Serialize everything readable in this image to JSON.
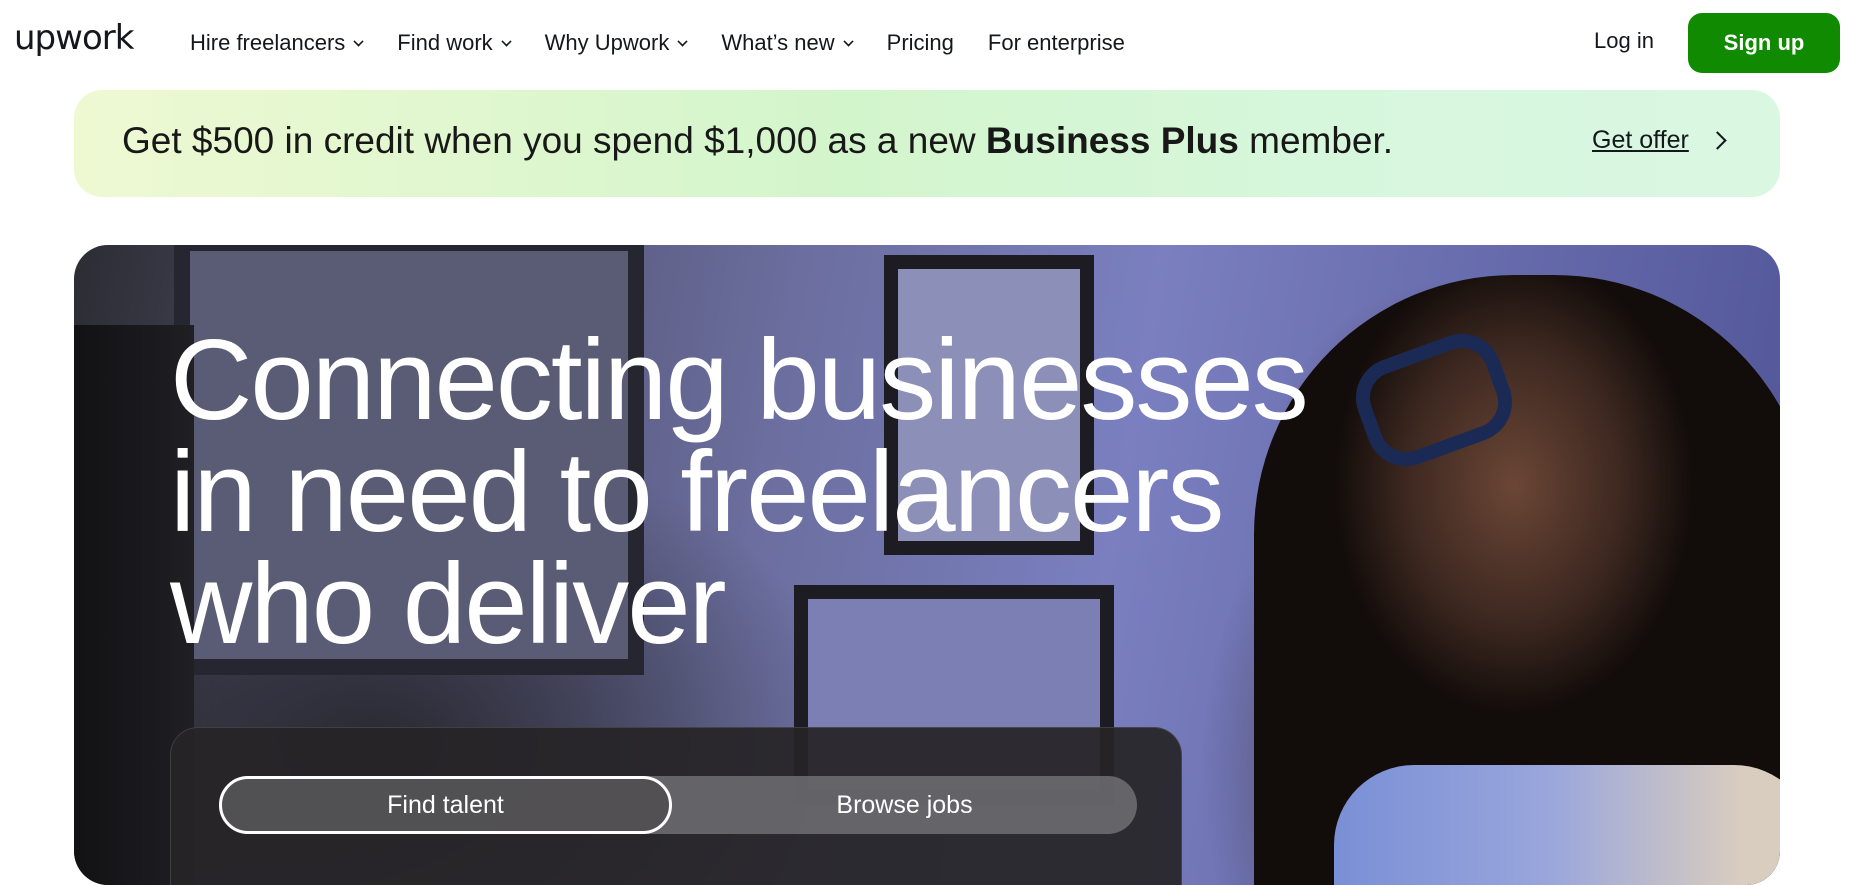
{
  "nav": {
    "logo": "upwork",
    "items": [
      {
        "label": "Hire freelancers",
        "has_dropdown": true
      },
      {
        "label": "Find work",
        "has_dropdown": true
      },
      {
        "label": "Why Upwork",
        "has_dropdown": true
      },
      {
        "label": "What’s new",
        "has_dropdown": true
      },
      {
        "label": "Pricing",
        "has_dropdown": false
      },
      {
        "label": "For enterprise",
        "has_dropdown": false
      }
    ],
    "login": "Log in",
    "signup": "Sign up"
  },
  "promo": {
    "text_before": "Get $500 in credit when you spend $1,000 as a new ",
    "text_bold": "Business Plus",
    "text_after": " member.",
    "cta": "Get offer",
    "cta_icon": "chevron-right-icon"
  },
  "hero": {
    "headline_lines": [
      "Connecting businesses",
      "in need to freelancers",
      "who deliver"
    ],
    "tabs": [
      {
        "label": "Find talent",
        "active": true
      },
      {
        "label": "Browse jobs",
        "active": false
      }
    ]
  },
  "colors": {
    "brand_green": "#108a00",
    "text_dark": "#14181c",
    "white": "#ffffff"
  }
}
